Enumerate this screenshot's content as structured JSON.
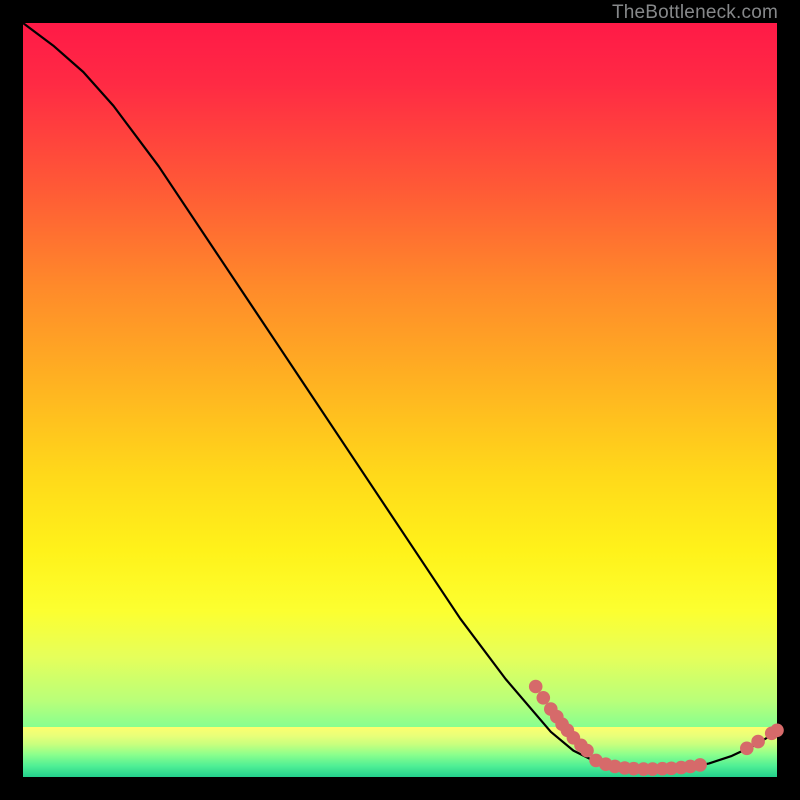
{
  "watermark": "TheBottleneck.com",
  "colors": {
    "page_bg": "#000000",
    "curve": "#000000",
    "dot": "#d66a6a",
    "watermark": "#86888a"
  },
  "chart_data": {
    "type": "line",
    "title": "",
    "xlabel": "",
    "ylabel": "",
    "xlim": [
      0,
      100
    ],
    "ylim": [
      0,
      100
    ],
    "grid": false,
    "legend": false,
    "series": [
      {
        "name": "curve",
        "x": [
          0,
          4,
          8,
          12,
          18,
          26,
          34,
          42,
          50,
          58,
          64,
          70,
          73,
          76,
          79,
          82,
          85,
          88,
          91,
          94,
          97,
          100
        ],
        "y": [
          100,
          97,
          93.5,
          89,
          81,
          69,
          57,
          45,
          33,
          21,
          13,
          6,
          3.5,
          2,
          1.3,
          1,
          1,
          1.2,
          1.8,
          2.8,
          4.2,
          6
        ]
      }
    ],
    "points": [
      {
        "name": "cluster-left-descent",
        "x": 68,
        "y": 12
      },
      {
        "name": "cluster-left-descent",
        "x": 69,
        "y": 10.5
      },
      {
        "name": "cluster-left-descent",
        "x": 70,
        "y": 9
      },
      {
        "name": "cluster-left-descent",
        "x": 70.8,
        "y": 8
      },
      {
        "name": "cluster-left-descent",
        "x": 71.5,
        "y": 7
      },
      {
        "name": "cluster-left-descent",
        "x": 72.2,
        "y": 6.2
      },
      {
        "name": "cluster-left-descent",
        "x": 73,
        "y": 5.2
      },
      {
        "name": "cluster-left-descent",
        "x": 74,
        "y": 4.2
      },
      {
        "name": "cluster-left-descent",
        "x": 74.8,
        "y": 3.5
      },
      {
        "name": "valley-floor",
        "x": 76,
        "y": 2.2
      },
      {
        "name": "valley-floor",
        "x": 77.3,
        "y": 1.7
      },
      {
        "name": "valley-floor",
        "x": 78.5,
        "y": 1.4
      },
      {
        "name": "valley-floor",
        "x": 79.8,
        "y": 1.2
      },
      {
        "name": "valley-floor",
        "x": 81,
        "y": 1.1
      },
      {
        "name": "valley-floor",
        "x": 82.3,
        "y": 1.05
      },
      {
        "name": "valley-floor",
        "x": 83.5,
        "y": 1.05
      },
      {
        "name": "valley-floor",
        "x": 84.8,
        "y": 1.1
      },
      {
        "name": "valley-floor",
        "x": 86,
        "y": 1.15
      },
      {
        "name": "valley-floor",
        "x": 87.3,
        "y": 1.25
      },
      {
        "name": "valley-floor",
        "x": 88.5,
        "y": 1.4
      },
      {
        "name": "valley-floor",
        "x": 89.8,
        "y": 1.6
      },
      {
        "name": "right-rise",
        "x": 96,
        "y": 3.8
      },
      {
        "name": "right-rise",
        "x": 97.5,
        "y": 4.7
      },
      {
        "name": "right-rise",
        "x": 99.3,
        "y": 5.8
      },
      {
        "name": "right-rise",
        "x": 100,
        "y": 6.2
      }
    ]
  }
}
